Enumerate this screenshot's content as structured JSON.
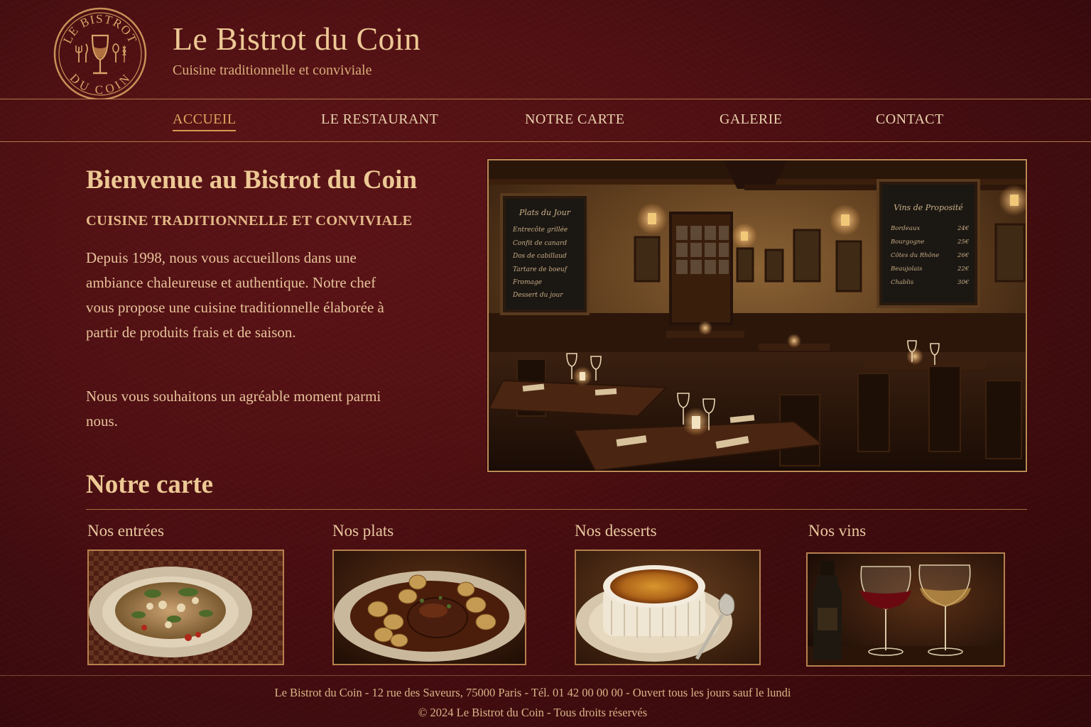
{
  "brand": {
    "title": "Le Bistrot du Coin",
    "tagline": "Cuisine traditionnelle et conviviale",
    "logo_text_top": "LE BISTROT",
    "logo_text_bottom": "DU COIN"
  },
  "nav": {
    "items": [
      {
        "label": "ACCUEIL",
        "active": true
      },
      {
        "label": "LE RESTAURANT",
        "active": false
      },
      {
        "label": "NOTRE CARTE",
        "active": false
      },
      {
        "label": "GALERIE",
        "active": false
      },
      {
        "label": "CONTACT",
        "active": false
      }
    ]
  },
  "intro": {
    "title": "Bienvenue au Bistrot du Coin",
    "subtitle": "CUISINE TRADITIONNELLE ET CONVIVIALE",
    "paragraph1": "Depuis 1998, nous vous accueillons dans une ambiance chaleureuse et authentique. Notre chef vous propose une cuisine traditionnelle élaborée à partir de produits frais et de saison.",
    "paragraph2": "Nous vous souhaitons un agréable moment parmi nous."
  },
  "hero": {
    "chalkboard_left": {
      "title": "Plats du Jour",
      "items": [
        "Entrecôte grillée",
        "Confit de canard",
        "Dos de cabillaud",
        "Tartare de boeuf",
        "Fromage",
        "Dessert du jour"
      ]
    },
    "chalkboard_right": {
      "title": "Vins de Proposité",
      "items": [
        {
          "name": "Bordeaux",
          "price": "24€"
        },
        {
          "name": "Bourgogne",
          "price": "25€"
        },
        {
          "name": "Côtes du Rhône",
          "price": "26€"
        },
        {
          "name": "Beaujolais",
          "price": "22€"
        },
        {
          "name": "Chablis",
          "price": "30€"
        }
      ]
    }
  },
  "carte": {
    "title": "Notre carte",
    "categories": [
      {
        "label": "Nos entrées",
        "image": "salad-plate"
      },
      {
        "label": "Nos plats",
        "image": "braised-meat-potatoes"
      },
      {
        "label": "Nos desserts",
        "image": "creme-brulee"
      },
      {
        "label": "Nos vins",
        "image": "wine-glasses"
      }
    ]
  },
  "footer": {
    "line1": "Le Bistrot du Coin - 12 rue des Saveurs, 75000 Paris - Tél. 01 42 00 00 00 - Ouvert tous les jours sauf le lundi",
    "line2": "© 2024 Le Bistrot du Coin - Tous droits réservés"
  },
  "colors": {
    "background": "#4a0e12",
    "gold": "#edc995",
    "accent": "#e0a55e",
    "rule": "#b07a4a"
  }
}
